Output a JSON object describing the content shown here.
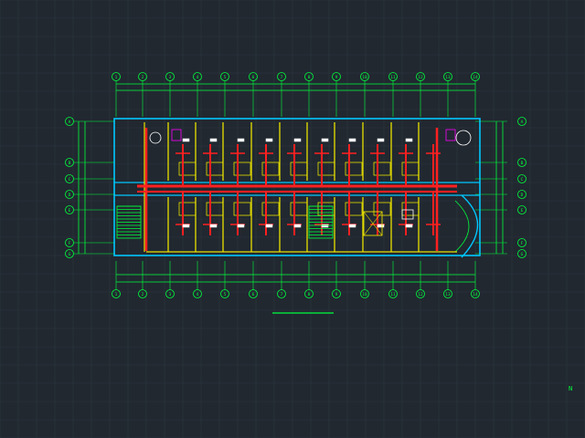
{
  "colors": {
    "background": "#212830",
    "grid": "#2c343e",
    "wall": "#00c8ff",
    "partition": "#e8e000",
    "duct": "#ff2020",
    "dimension": "#00ff3c",
    "fixture": "#ffffff",
    "accent": "#ff00ff"
  },
  "axis_labels": {
    "columns": [
      "1",
      "2",
      "3",
      "4",
      "5",
      "6",
      "7",
      "8",
      "9",
      "10",
      "11",
      "12",
      "13",
      "14"
    ],
    "rows": [
      "A",
      "B",
      "C",
      "D",
      "E",
      "F",
      "G"
    ]
  },
  "drawing": {
    "caption": "",
    "note": "",
    "corner_mark": "N"
  }
}
